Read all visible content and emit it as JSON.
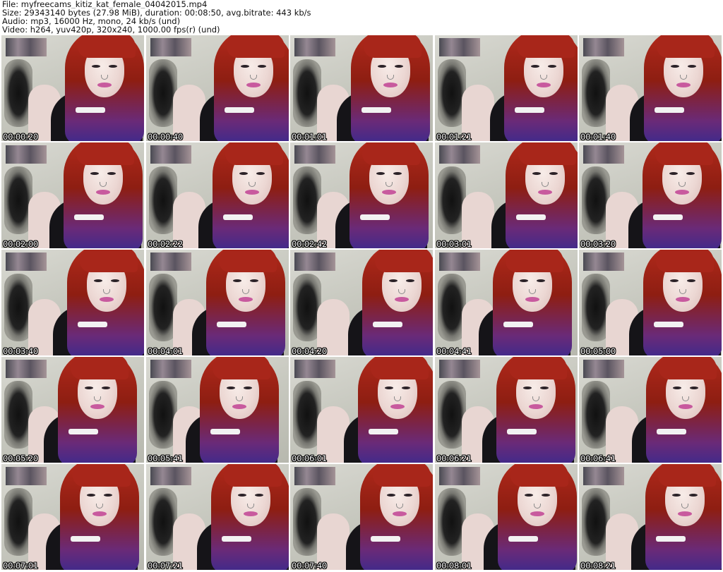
{
  "header": {
    "file_line": "File: myfreecams_kitiz_kat_female_04042015.mp4",
    "size_line": "Size: 29343140 bytes (27.98 MiB), duration: 00:08:50, avg.bitrate: 443 kb/s",
    "audio_line": "Audio: mp3, 16000 Hz, mono, 24 kb/s (und)",
    "video_line": "Video: h264, yuv420p, 320x240, 1000.00 fps(r) (und)"
  },
  "thumbnails": [
    {
      "timestamp": "00:00:20"
    },
    {
      "timestamp": "00:00:40"
    },
    {
      "timestamp": "00:01:01"
    },
    {
      "timestamp": "00:01:21"
    },
    {
      "timestamp": "00:01:40"
    },
    {
      "timestamp": "00:02:00"
    },
    {
      "timestamp": "00:02:22"
    },
    {
      "timestamp": "00:02:42"
    },
    {
      "timestamp": "00:03:01"
    },
    {
      "timestamp": "00:03:20"
    },
    {
      "timestamp": "00:03:40"
    },
    {
      "timestamp": "00:04:01"
    },
    {
      "timestamp": "00:04:20"
    },
    {
      "timestamp": "00:04:41"
    },
    {
      "timestamp": "00:05:00"
    },
    {
      "timestamp": "00:05:20"
    },
    {
      "timestamp": "00:05:41"
    },
    {
      "timestamp": "00:06:01"
    },
    {
      "timestamp": "00:06:21"
    },
    {
      "timestamp": "00:06:41"
    },
    {
      "timestamp": "00:07:01"
    },
    {
      "timestamp": "00:07:21"
    },
    {
      "timestamp": "00:07:40"
    },
    {
      "timestamp": "00:08:01"
    },
    {
      "timestamp": "00:08:21"
    }
  ]
}
